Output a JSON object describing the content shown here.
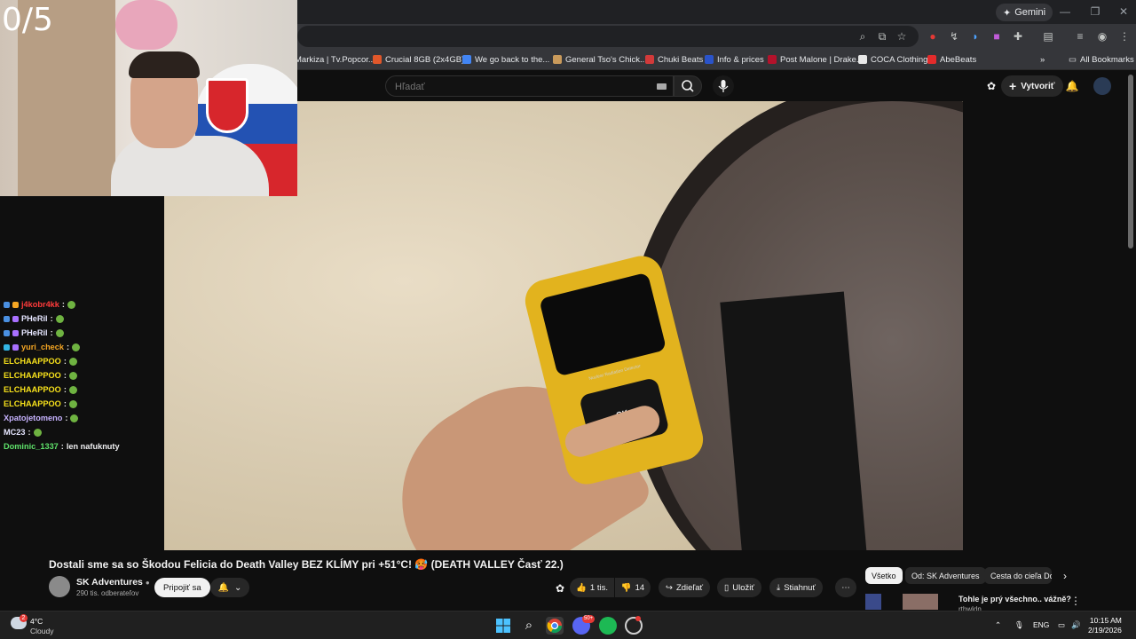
{
  "webcam": {
    "counter": "0/5"
  },
  "browser": {
    "gemini_label": "Gemini",
    "bookmarks": [
      {
        "label": "Markiza | Tv.Popcor...",
        "color": "#3a3a3a"
      },
      {
        "label": "Crucial 8GB (2x4GB)...",
        "color": "#e0572a"
      },
      {
        "label": "We go back to the...",
        "color": "#4285f4"
      },
      {
        "label": "General Tso's Chick...",
        "color": "#c99a5b"
      },
      {
        "label": "Chuki Beats",
        "color": "#d23a3a"
      },
      {
        "label": "Info & prices",
        "color": "#2a53c9"
      },
      {
        "label": "Post Malone | Drake...",
        "color": "#b3122b"
      },
      {
        "label": "COCA Clothing",
        "color": "#e8e8e8"
      },
      {
        "label": "AbeBeats",
        "color": "#e32b2b"
      }
    ],
    "all_bookmarks": "All Bookmarks"
  },
  "youtube": {
    "search_placeholder": "Hľadať",
    "create_label": "Vytvoriť"
  },
  "chat": [
    {
      "user": "j4kobr4kk",
      "color": "#ff3b3b",
      "text": ""
    },
    {
      "user": "PHeRil",
      "color": "#e6e6ff",
      "text": ""
    },
    {
      "user": "PHeRil",
      "color": "#e6e6ff",
      "text": ""
    },
    {
      "user": "yuri_check",
      "color": "#f5a623",
      "text": ""
    },
    {
      "user": "ELCHAAPPOO",
      "color": "#f7e11b",
      "text": ""
    },
    {
      "user": "ELCHAAPPOO",
      "color": "#f7e11b",
      "text": ""
    },
    {
      "user": "ELCHAAPPOO",
      "color": "#f7e11b",
      "text": ""
    },
    {
      "user": "ELCHAAPPOO",
      "color": "#f7e11b",
      "text": ""
    },
    {
      "user": "Xpatojetomeno",
      "color": "#c7b3ff",
      "text": ""
    },
    {
      "user": "MC23",
      "color": "#e6e6ff",
      "text": ""
    },
    {
      "user": "Dominic_1337",
      "color": "#5fe36b",
      "text": "len nafuknuty"
    }
  ],
  "video": {
    "device_label": "Nuclear Radiation Detector",
    "ok_label": "OK",
    "title": "Dostali sme sa so Škodou Felicia do Death Valley BEZ KLÍMY pri +51°C! 🥵 (DEATH VALLEY Časť 22.)",
    "channel": "SK Adventures",
    "subscribers": "290 tis. odberateľov",
    "join_label": "Pripojiť sa",
    "likes": "1 tis.",
    "dislikes": "14",
    "share_label": "Zdieľať",
    "save_label": "Uložiť",
    "download_label": "Stiahnuť"
  },
  "sidebar_chips": [
    "Všetko",
    "Od: SK Adventures",
    "Cesta do cieľa Do"
  ],
  "recommendation": {
    "title": "Tohle je prý všechno.. vážně?",
    "channel": "rthwldn"
  },
  "taskbar": {
    "temp": "4°C",
    "condition": "Cloudy",
    "weather_badge": "2",
    "discord_badge": "50+",
    "lang": "ENG",
    "time": "10:15 AM",
    "date": "2/19/2026"
  }
}
